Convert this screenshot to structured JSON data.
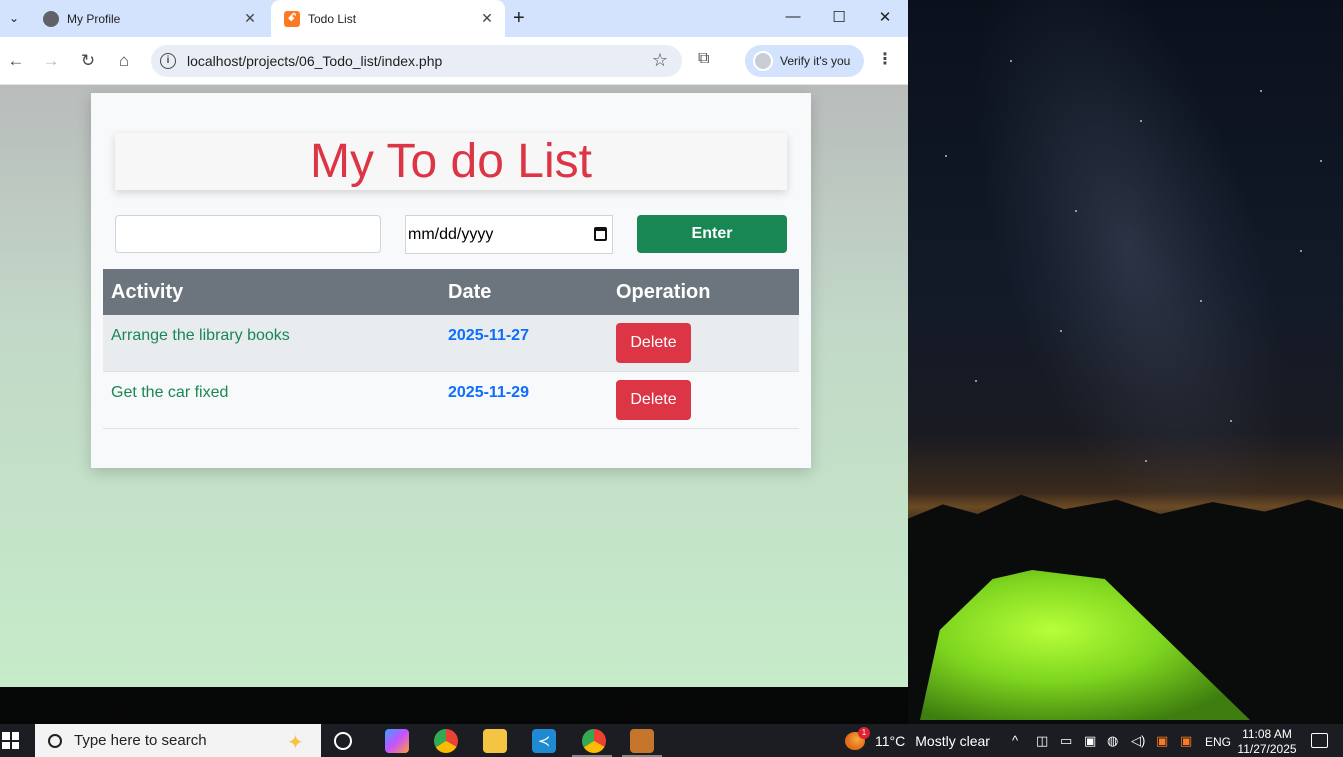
{
  "browser": {
    "tabs": [
      {
        "title": "My Profile",
        "favicon": "globe-icon",
        "active": false
      },
      {
        "title": "Todo List",
        "favicon": "xampp-icon",
        "active": true
      }
    ],
    "url": "localhost/projects/06_Todo_list/index.php",
    "profile_button": "Verify it's you"
  },
  "app": {
    "heading": "My To do List",
    "activity_input_value": "",
    "date_input_placeholder": "mm/dd/yyyy",
    "enter_label": "Enter",
    "table": {
      "headers": [
        "Activity",
        "Date",
        "Operation"
      ],
      "rows": [
        {
          "activity": "Arrange the library books",
          "date": "2025-11-27",
          "action": "Delete"
        },
        {
          "activity": "Get the car fixed",
          "date": "2025-11-29",
          "action": "Delete"
        }
      ]
    }
  },
  "taskbar": {
    "search_placeholder": "Type here to search",
    "weather": {
      "temperature": "11°C",
      "condition": "Mostly clear",
      "badge": "1"
    },
    "language": "ENG",
    "time": "11:08 AM",
    "date": "11/27/2025"
  },
  "colors": {
    "heading": "#dc3545",
    "enter_button": "#198754",
    "delete_button": "#dc3545",
    "table_header": "#6c757d",
    "activity_text": "#198754",
    "date_text": "#0d6efd"
  }
}
